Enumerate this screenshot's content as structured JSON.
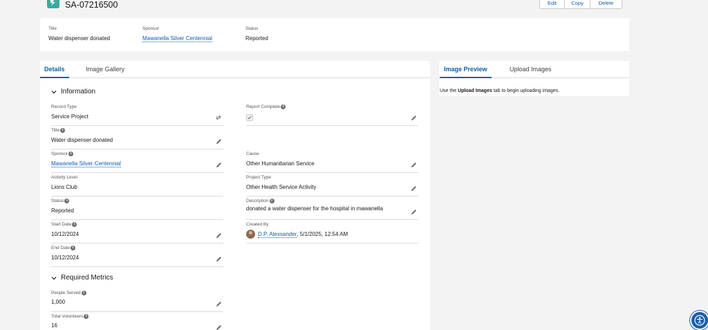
{
  "record": {
    "icon": "service-activity-icon",
    "title": "SA-07216500",
    "actions": {
      "edit": "Edit",
      "copy": "Copy",
      "delete": "Delete"
    }
  },
  "highlights": {
    "title_label": "Title",
    "title_value": "Water dispenser donated",
    "sponsor_label": "Sponsor",
    "sponsor_value": "Mawanella Silver Centennial",
    "status_label": "Status",
    "status_value": "Reported"
  },
  "details_tabs": {
    "details": "Details",
    "gallery": "Image Gallery"
  },
  "sections": {
    "information": "Information",
    "required_metrics": "Required Metrics"
  },
  "fields": {
    "record_type": {
      "label": "Record Type",
      "value": "Service Project"
    },
    "title": {
      "label": "Title",
      "value": "Water dispenser donated"
    },
    "sponsor": {
      "label": "Sponsor",
      "value": "Mawanella Silver Centennial"
    },
    "activity_level": {
      "label": "Activity Level",
      "value": "Lions Club"
    },
    "status": {
      "label": "Status",
      "value": "Reported"
    },
    "start_date": {
      "label": "Start Date",
      "value": "10/12/2024"
    },
    "end_date": {
      "label": "End Date",
      "value": "10/12/2024"
    },
    "report_complete": {
      "label": "Report Complete",
      "checked": true
    },
    "cause": {
      "label": "Cause",
      "value": "Other Humanitarian Service"
    },
    "project_type": {
      "label": "Project Type",
      "value": "Other Health Service Activity"
    },
    "description": {
      "label": "Description",
      "value": "donated a water dispenser for the hospital in mawanella"
    },
    "created_by": {
      "label": "Created By",
      "user": "D.P. Alexsander",
      "datetime": ", 5/1/2025, 12:54 AM"
    },
    "people_served": {
      "label": "People Served",
      "value": "1,000"
    },
    "total_volunteers": {
      "label": "Total Volunteers",
      "value": "16"
    }
  },
  "preview": {
    "tab_preview": "Image Preview",
    "tab_upload": "Upload Images",
    "msg_before": "Use the ",
    "msg_bold": "Upload Images",
    "msg_after": " tab to begin uploading images."
  },
  "colors": {
    "brand": "#0b5cab",
    "record_icon": "#3ba9a0",
    "accessibility": "#1b5fab"
  }
}
